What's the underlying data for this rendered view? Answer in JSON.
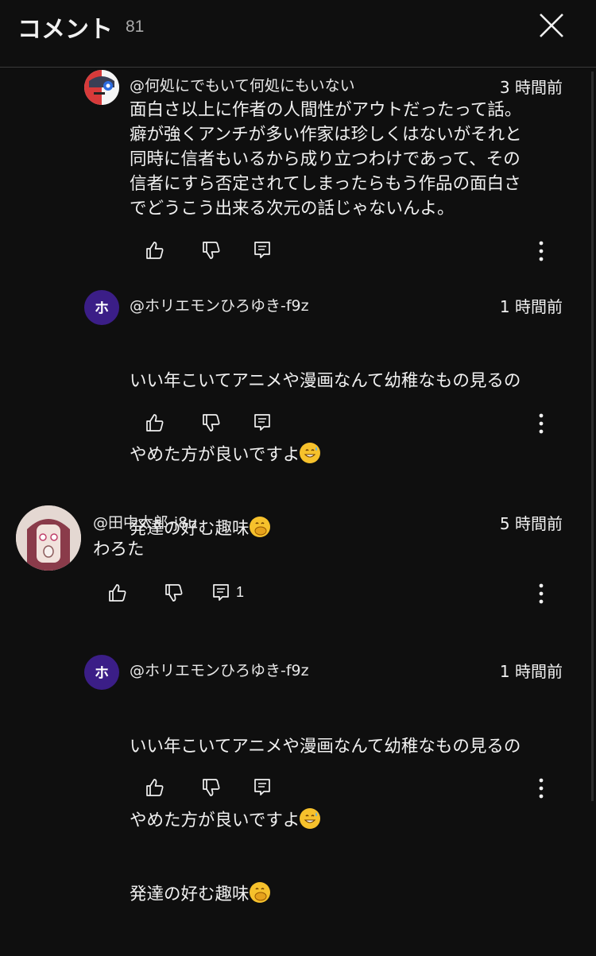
{
  "header": {
    "title": "コメント",
    "count": "81",
    "close_icon": "close-icon"
  },
  "comments": [
    {
      "author": "@何処にでもいて何処にもいない",
      "time": "3 時間前",
      "avatar": {
        "type": "image",
        "icon": "avatar-image"
      },
      "body": "面白さ以上に作者の人間性がアウトだったって話。\n癖が強くアンチが多い作家は珍しくはないがそれと\n同時に信者もいるから成り立つわけであって、その\n信者にすら否定されてしまったらもう作品の面白さ\nでどうこう出来る次元の話じゃないんよ。",
      "reply_count": ""
    },
    {
      "author": "@ホリエモンひろゆき-f9z",
      "time": "1 時間前",
      "avatar": {
        "type": "letter",
        "letter": "ホ",
        "color": "#3b1e87"
      },
      "body_line1": "いい年こいてアニメや漫画なんて幼稚なもの見るの",
      "body_line2": "やめた方が良いですよ",
      "body_line3": "発達の好む趣味",
      "emoji1": "grinning-sweat-emoji",
      "emoji2": "hand-over-mouth-emoji",
      "reply_count": ""
    },
    {
      "author": "@田中太郎-j8u",
      "time": "5 時間前",
      "avatar": {
        "type": "image",
        "icon": "avatar-image"
      },
      "body": "わろた",
      "reply_count": "1"
    },
    {
      "author": "@ホリエモンひろゆき-f9z",
      "time": "1 時間前",
      "avatar": {
        "type": "letter",
        "letter": "ホ",
        "color": "#3b1e87"
      },
      "body_line1": "いい年こいてアニメや漫画なんて幼稚なもの見るの",
      "body_line2": "やめた方が良いですよ",
      "body_line3": "発達の好む趣味",
      "emoji1": "grinning-sweat-emoji",
      "emoji2": "hand-over-mouth-emoji",
      "reply_count": ""
    }
  ],
  "icons": {
    "like": "thumbs-up-icon",
    "dislike": "thumbs-down-icon",
    "reply": "reply-icon",
    "more": "more-vert-icon"
  },
  "colors": {
    "background": "#0f0f0f",
    "text": "#f1f1f1",
    "muted": "#aaaaaa",
    "avatar_letter_bg": "#3b1e87"
  }
}
